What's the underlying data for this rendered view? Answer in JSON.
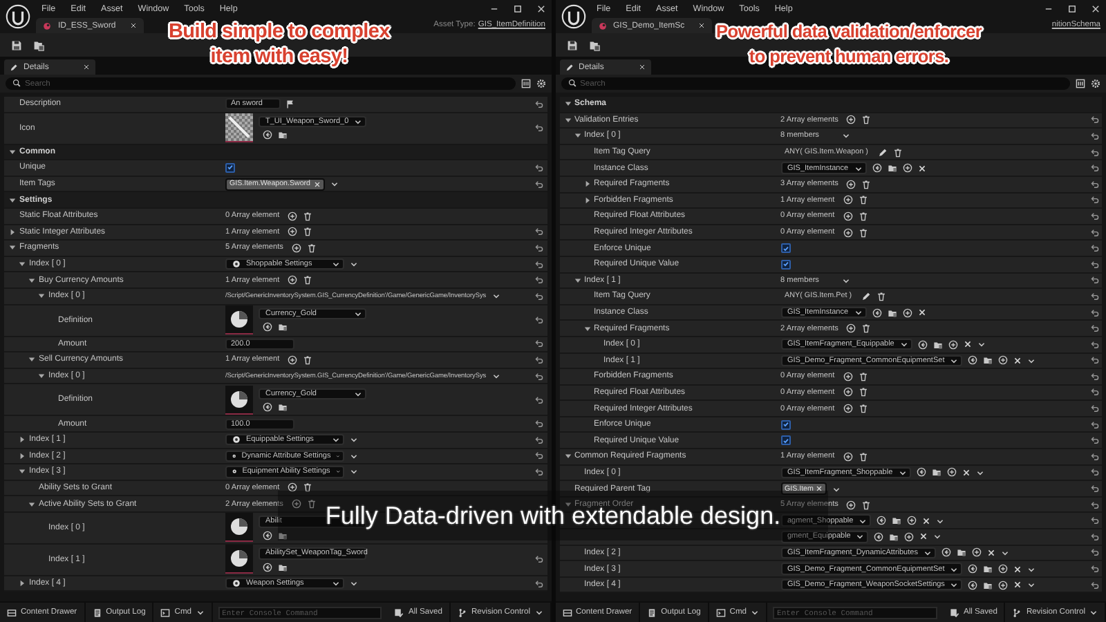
{
  "windows": [
    {
      "menu": [
        "File",
        "Edit",
        "Asset",
        "Window",
        "Tools",
        "Help"
      ],
      "tab": "ID_ESS_Sword",
      "asset_type": {
        "label": "Asset Type:",
        "value": "GIS_ItemDefinition"
      },
      "panel_tab": "Details",
      "search_placeholder": "Search",
      "rows": [
        {
          "label": "Description",
          "kind": "localized",
          "value": "An sword",
          "modified": true
        },
        {
          "label": "Icon",
          "kind": "texture",
          "value": "T_UI_Weapon_Sword_0",
          "modified": true
        },
        {
          "label": "Common",
          "kind": "category",
          "expanded": true,
          "children": [
            {
              "label": "Unique",
              "kind": "checkbox",
              "checked": true,
              "modified": true
            },
            {
              "label": "Item Tags",
              "kind": "tags",
              "tags": [
                "GIS.Item.Weapon.Sword"
              ],
              "modified": true
            }
          ]
        },
        {
          "label": "Settings",
          "kind": "category",
          "expanded": true,
          "children": [
            {
              "label": "Static Float Attributes",
              "kind": "array",
              "value": "0 Array element",
              "modified": false
            },
            {
              "label": "Static Integer Attributes",
              "kind": "array",
              "value": "1 Array element",
              "expanded": false,
              "modified": true
            },
            {
              "label": "Fragments",
              "kind": "array",
              "value": "5 Array elements",
              "expanded": true,
              "modified": true,
              "children": [
                {
                  "label": "Index [ 0 ]",
                  "kind": "instanced",
                  "value": "Shoppable Settings",
                  "expanded": true,
                  "modified": true,
                  "children": [
                    {
                      "label": "Buy Currency Amounts",
                      "kind": "array",
                      "value": "1 Array element",
                      "expanded": true,
                      "modified": true,
                      "children": [
                        {
                          "label": "Index [ 0 ]",
                          "kind": "path",
                          "value": "/Script/GenericInventorySystem.GIS_CurrencyDefinition'/Game/GenericGame/InventorySys",
                          "expanded": true,
                          "modified": true,
                          "children": [
                            {
                              "label": "Definition",
                              "kind": "asset",
                              "value": "Currency_Gold",
                              "modified": true
                            },
                            {
                              "label": "Amount",
                              "kind": "text",
                              "value": "200.0",
                              "modified": true
                            }
                          ]
                        }
                      ]
                    },
                    {
                      "label": "Sell Currency Amounts",
                      "kind": "array",
                      "value": "1 Array element",
                      "expanded": true,
                      "modified": true,
                      "children": [
                        {
                          "label": "Index [ 0 ]",
                          "kind": "path",
                          "value": "/Script/GenericInventorySystem.GIS_CurrencyDefinition'/Game/GenericGame/InventorySys",
                          "expanded": true,
                          "modified": true,
                          "children": [
                            {
                              "label": "Definition",
                              "kind": "asset",
                              "value": "Currency_Gold",
                              "modified": true
                            },
                            {
                              "label": "Amount",
                              "kind": "text",
                              "value": "100.0",
                              "modified": true
                            }
                          ]
                        }
                      ]
                    }
                  ]
                },
                {
                  "label": "Index [ 1 ]",
                  "kind": "instanced",
                  "value": "Equippable Settings",
                  "expanded": false,
                  "modified": true
                },
                {
                  "label": "Index [ 2 ]",
                  "kind": "instanced",
                  "value": "Dynamic Attribute Settings",
                  "expanded": false,
                  "modified": true
                },
                {
                  "label": "Index [ 3 ]",
                  "kind": "instanced",
                  "value": "Equipment Ability Settings",
                  "expanded": true,
                  "modified": true,
                  "children": [
                    {
                      "label": "Ability Sets to Grant",
                      "kind": "array",
                      "value": "0 Array element",
                      "modified": false
                    },
                    {
                      "label": "Active Ability Sets to Grant",
                      "kind": "array",
                      "value": "2 Array elements",
                      "expanded": true,
                      "modified": false,
                      "children": [
                        {
                          "label": "Index [ 0 ]",
                          "kind": "asset",
                          "value": "Abilit",
                          "modified": false
                        },
                        {
                          "label": "Index [ 1 ]",
                          "kind": "asset",
                          "value": "AbilitySet_WeaponTag_Sword",
                          "modified": true
                        }
                      ]
                    }
                  ]
                },
                {
                  "label": "Index [ 4 ]",
                  "kind": "instanced",
                  "value": "Weapon Settings",
                  "expanded": false,
                  "modified": true
                }
              ]
            }
          ]
        }
      ],
      "status": {
        "content_drawer": "Content Drawer",
        "output_log": "Output Log",
        "cmd": "Cmd",
        "console_placeholder": "Enter Console Command",
        "saved": "All Saved",
        "revision": "Revision Control"
      }
    },
    {
      "menu": [
        "File",
        "Edit",
        "Asset",
        "Window",
        "Tools",
        "Help"
      ],
      "tab": "GIS_Demo_ItemSc",
      "asset_type": {
        "value": "nitionSchema"
      },
      "panel_tab": "Details",
      "search_placeholder": "Search",
      "rows": [
        {
          "label": "Schema",
          "kind": "category",
          "expanded": true,
          "children": [
            {
              "label": "Validation Entries",
              "kind": "array",
              "value": "2 Array elements",
              "expanded": true,
              "modified": true,
              "children": [
                {
                  "label": "Index [ 0 ]",
                  "kind": "members",
                  "value": "8 members",
                  "expanded": true,
                  "modified": true,
                  "children": [
                    {
                      "label": "Item Tag Query",
                      "kind": "query",
                      "value": "ANY( GIS.Item.Weapon )",
                      "modified": true
                    },
                    {
                      "label": "Instance Class",
                      "kind": "class",
                      "value": "GIS_ItemInstance",
                      "modified": true
                    },
                    {
                      "label": "Required Fragments",
                      "kind": "array",
                      "value": "3 Array elements",
                      "expanded": false,
                      "modified": true
                    },
                    {
                      "label": "Forbidden Fragments",
                      "kind": "array",
                      "value": "1 Array element",
                      "expanded": false,
                      "modified": true
                    },
                    {
                      "label": "Required Float Attributes",
                      "kind": "array",
                      "value": "0 Array element",
                      "modified": true
                    },
                    {
                      "label": "Required Integer Attributes",
                      "kind": "array",
                      "value": "0 Array element",
                      "modified": true
                    },
                    {
                      "label": "Enforce Unique",
                      "kind": "checkbox",
                      "checked": true,
                      "modified": true
                    },
                    {
                      "label": "Required Unique Value",
                      "kind": "checkbox",
                      "checked": true,
                      "modified": true
                    }
                  ]
                },
                {
                  "label": "Index [ 1 ]",
                  "kind": "members",
                  "value": "8 members",
                  "expanded": true,
                  "modified": true,
                  "children": [
                    {
                      "label": "Item Tag Query",
                      "kind": "query",
                      "value": "ANY( GIS.Item.Pet )",
                      "modified": true
                    },
                    {
                      "label": "Instance Class",
                      "kind": "class",
                      "value": "GIS_ItemInstance",
                      "modified": true
                    },
                    {
                      "label": "Required Fragments",
                      "kind": "array",
                      "value": "2 Array elements",
                      "expanded": true,
                      "modified": true,
                      "children": [
                        {
                          "label": "Index [ 0 ]",
                          "kind": "element",
                          "value": "GIS_ItemFragment_Equippable",
                          "modified": true
                        },
                        {
                          "label": "Index [ 1 ]",
                          "kind": "element",
                          "value": "GIS_Demo_Fragment_CommonEquipmentSet",
                          "modified": true
                        }
                      ]
                    },
                    {
                      "label": "Forbidden Fragments",
                      "kind": "array",
                      "value": "0 Array element",
                      "modified": true
                    },
                    {
                      "label": "Required Float Attributes",
                      "kind": "array",
                      "value": "0 Array element",
                      "modified": true
                    },
                    {
                      "label": "Required Integer Attributes",
                      "kind": "array",
                      "value": "0 Array element",
                      "modified": true
                    },
                    {
                      "label": "Enforce Unique",
                      "kind": "checkbox",
                      "checked": true,
                      "modified": true
                    },
                    {
                      "label": "Required Unique Value",
                      "kind": "checkbox",
                      "checked": true,
                      "modified": true
                    }
                  ]
                }
              ]
            },
            {
              "label": "Common Required Fragments",
              "kind": "array",
              "value": "1 Array element",
              "expanded": true,
              "modified": true,
              "children": [
                {
                  "label": "Index [ 0 ]",
                  "kind": "element",
                  "value": "GIS_ItemFragment_Shoppable",
                  "modified": true
                }
              ]
            },
            {
              "label": "Required Parent Tag",
              "kind": "tags",
              "tags": [
                "GIS.Item"
              ],
              "modified": true
            },
            {
              "label": "Fragment Order",
              "kind": "array",
              "value": "5 Array elements",
              "expanded": true,
              "modified": true,
              "children": [
                {
                  "kind": "element",
                  "value": "agment_Shoppable",
                  "modified": true
                },
                {
                  "kind": "element",
                  "value": "gment_Equippable",
                  "modified": true
                },
                {
                  "label": "Index [ 2 ]",
                  "kind": "element",
                  "value": "GIS_ItemFragment_DynamicAttributes",
                  "modified": true
                },
                {
                  "label": "Index [ 3 ]",
                  "kind": "element",
                  "value": "GIS_Demo_Fragment_CommonEquipmentSet",
                  "modified": true
                },
                {
                  "label": "Index [ 4 ]",
                  "kind": "element",
                  "value": "GIS_Demo_Fragment_WeaponSocketSettings",
                  "modified": true
                }
              ]
            }
          ]
        }
      ],
      "status": {
        "content_drawer": "Content Drawer",
        "output_log": "Output Log",
        "cmd": "Cmd",
        "console_placeholder": "Enter Console Command",
        "saved": "All Saved",
        "revision": "Revision Control"
      }
    }
  ],
  "captions": [
    {
      "kind": "headline",
      "text": "Build simple to complex\nitem with easy!"
    },
    {
      "kind": "headline",
      "text": "Powerful data validation/enforcer\nto prevent human errors."
    },
    {
      "kind": "banner",
      "text": "Fully Data-driven with extendable design."
    }
  ]
}
